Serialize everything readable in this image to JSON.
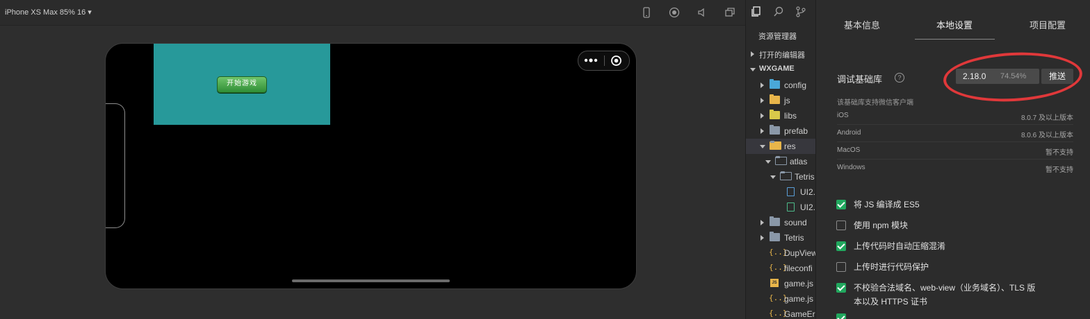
{
  "simulator": {
    "device_label": "iPhone XS Max 85% 16 ▾",
    "toolbar_icons": [
      "phone-icon",
      "record-icon",
      "volume-icon",
      "window-icon"
    ],
    "start_button_label": "开始游戏"
  },
  "explorer": {
    "title": "资源管理器",
    "items": [
      {
        "label": "打开的编辑器"
      },
      {
        "label": "WXGAME"
      },
      {
        "label": "config"
      },
      {
        "label": "js"
      },
      {
        "label": "libs"
      },
      {
        "label": "prefab"
      },
      {
        "label": "res"
      },
      {
        "label": "atlas"
      },
      {
        "label": "Tetris"
      },
      {
        "label": "UI2."
      },
      {
        "label": "UI2."
      },
      {
        "label": "sound"
      },
      {
        "label": "Tetris"
      },
      {
        "label": "DupView"
      },
      {
        "label": "fileconfi"
      },
      {
        "label": "game.js"
      },
      {
        "label": "game.js"
      },
      {
        "label": "GameEr"
      }
    ]
  },
  "settings": {
    "tabs": [
      {
        "label": "基本信息"
      },
      {
        "label": "本地设置"
      },
      {
        "label": "项目配置"
      }
    ],
    "active_tab": "本地设置",
    "lib_label": "调试基础库",
    "version": "2.18.0",
    "version_percent": "74.54%",
    "push_label": "推送",
    "support_note": "该基础库支持微信客户端",
    "platforms": [
      {
        "name": "iOS",
        "value": "8.0.7 及以上版本"
      },
      {
        "name": "Android",
        "value": "8.0.6 及以上版本"
      },
      {
        "name": "MacOS",
        "value": "暂不支持"
      },
      {
        "name": "Windows",
        "value": "暂不支持"
      }
    ],
    "options": [
      {
        "label": "将 JS 编译成 ES5",
        "checked": true
      },
      {
        "label": "使用 npm 模块",
        "checked": false
      },
      {
        "label": "上传代码时自动压缩混淆",
        "checked": true
      },
      {
        "label": "上传时进行代码保护",
        "checked": false
      },
      {
        "label": "不校验合法域名、web-view（业务域名）、TLS 版",
        "label2": "本以及 HTTPS 证书",
        "checked": true
      }
    ],
    "accent_color": "#21a85e",
    "highlight_color": "#e0383a"
  }
}
